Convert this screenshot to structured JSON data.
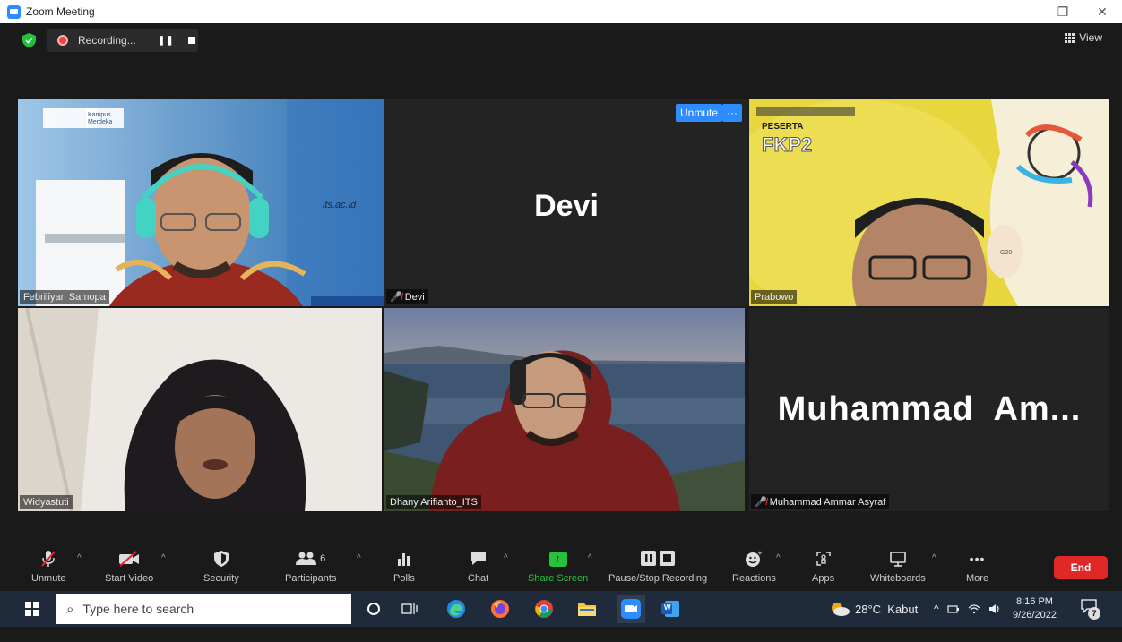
{
  "window": {
    "title": "Zoom Meeting",
    "minimize": "—",
    "restore": "❐",
    "close": "✕"
  },
  "recording": {
    "label": "Recording...",
    "pause": "❚❚"
  },
  "view": {
    "label": "View"
  },
  "tiles": [
    {
      "name": "Febriliyan Samopa",
      "muted": false,
      "active": true,
      "overlay_text": "its.ac.id",
      "logo_text": "Kampus Merdeka"
    },
    {
      "name": "Devi",
      "muted": true,
      "display_name": "Devi",
      "unmute_label": "Unmute",
      "more_label": "···"
    },
    {
      "name": "Prabowo",
      "muted": false,
      "banner_title": "PESERTA",
      "banner_subtitle": "FKP2",
      "badge": "G20"
    },
    {
      "name": "Widyastuti",
      "muted": false
    },
    {
      "name": "Dhany Arifianto_ITS",
      "muted": false
    },
    {
      "name": "Muhammad Ammar Asyraf",
      "muted": true,
      "display_name": "Muhammad  Am..."
    }
  ],
  "toolbar": {
    "unmute": "Unmute",
    "start_video": "Start Video",
    "security": "Security",
    "participants": "Participants",
    "participants_count": "6",
    "polls": "Polls",
    "chat": "Chat",
    "share_screen": "Share Screen",
    "pause_stop_recording": "Pause/Stop Recording",
    "reactions": "Reactions",
    "apps": "Apps",
    "whiteboards": "Whiteboards",
    "more": "More",
    "more_icon": "•••",
    "end": "End"
  },
  "taskbar": {
    "search_placeholder": "Type here to search",
    "weather": "28°C  Kabut",
    "time": "8:16 PM",
    "date": "9/26/2022",
    "notifications": "7",
    "word_label": "W"
  },
  "colors": {
    "zoom_blue": "#2d8cff",
    "end_red": "#e02828",
    "share_green": "#27c13b",
    "active_border": "#e2f07a"
  }
}
